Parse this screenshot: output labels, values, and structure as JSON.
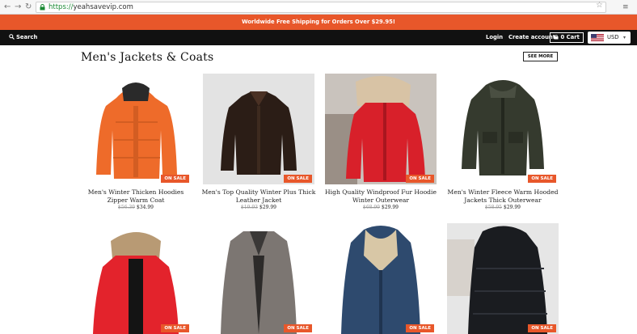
{
  "browser": {
    "url_scheme": "https://",
    "url_host": "yeahsavevip.com"
  },
  "announcement": "Worldwide Free Shipping for Orders Over $29.95!",
  "header": {
    "search_label": "Search",
    "login_label": "Login",
    "create_account_label": "Create account",
    "cart_label": "0 Cart",
    "currency": "USD"
  },
  "section": {
    "title": "Men's Jackets & Coats",
    "see_more_label": "SEE MORE"
  },
  "colors": {
    "accent": "#e8572a",
    "header_bg": "#111111"
  },
  "products": [
    {
      "title": "Men's Winter Thicken Hoodies Zipper Warm Coat",
      "old_price": "$56.39",
      "price": "$34.99",
      "badge": "ON SALE"
    },
    {
      "title": "Men's Top Quality Winter Plus Thick Leather Jacket",
      "old_price": "$19.93",
      "price": "$29.99",
      "badge": "ON SALE"
    },
    {
      "title": "High Quality Windproof Fur Hoodie Winter Outerwear",
      "old_price": "$68.99",
      "price": "$29.99",
      "badge": "ON SALE"
    },
    {
      "title": "Men's Winter Fleece Warm Hooded Jackets Thick Outerwear",
      "old_price": "$58.95",
      "price": "$29.99",
      "badge": "ON SALE"
    },
    {
      "title": "",
      "old_price": "",
      "price": "",
      "badge": "ON SALE"
    },
    {
      "title": "",
      "old_price": "",
      "price": "",
      "badge": "ON SALE"
    },
    {
      "title": "",
      "old_price": "",
      "price": "",
      "badge": "ON SALE"
    },
    {
      "title": "",
      "old_price": "",
      "price": "",
      "badge": "ON SALE"
    }
  ]
}
